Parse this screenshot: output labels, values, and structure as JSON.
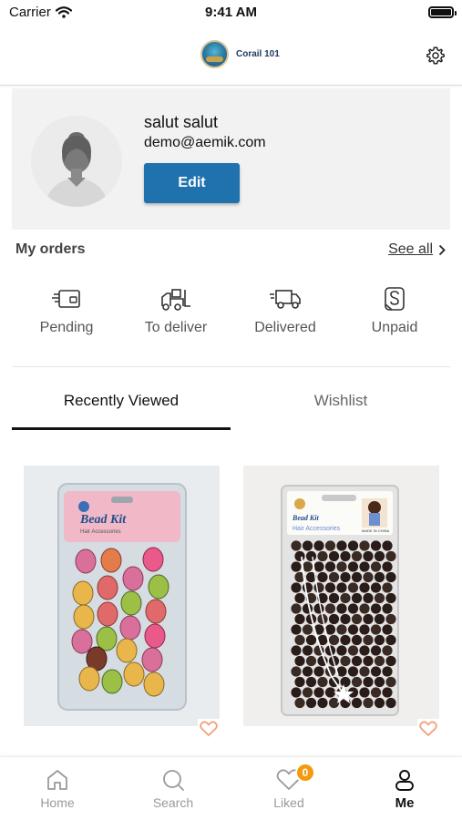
{
  "status_bar": {
    "carrier": "Carrier",
    "time": "9:41 AM"
  },
  "header": {
    "brand_name": "Corail 101"
  },
  "profile": {
    "name": "salut salut",
    "email": "demo@aemik.com",
    "edit_label": "Edit"
  },
  "orders": {
    "title": "My orders",
    "see_all": "See all",
    "items": [
      {
        "label": "Pending",
        "icon": "invoice-icon"
      },
      {
        "label": "To deliver",
        "icon": "forklift-icon"
      },
      {
        "label": "Delivered",
        "icon": "delivery-truck-icon"
      },
      {
        "label": "Unpaid",
        "icon": "payment-icon"
      }
    ]
  },
  "tabs": [
    {
      "label": "Recently Viewed",
      "active": true
    },
    {
      "label": "Wishlist",
      "active": false
    }
  ],
  "products": [
    {
      "package_title": "Bead Kit",
      "package_subtitle": "Hair Accessories"
    },
    {
      "package_title": "Bead Kit",
      "package_subtitle": "Hair Accessories",
      "made_in": "MADE IN CHINA"
    }
  ],
  "bottom_nav": [
    {
      "label": "Home",
      "icon": "home-icon",
      "active": false
    },
    {
      "label": "Search",
      "icon": "search-icon",
      "active": false
    },
    {
      "label": "Liked",
      "icon": "heart-icon",
      "active": false,
      "badge": "0"
    },
    {
      "label": "Me",
      "icon": "person-icon",
      "active": true
    }
  ],
  "colors": {
    "primary": "#1f72ad",
    "badge": "#f39a12",
    "heart": "#f2a07c",
    "card_bg": "#f2f2f2"
  }
}
